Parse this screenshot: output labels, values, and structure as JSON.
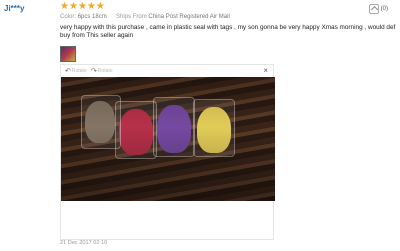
{
  "review": {
    "reviewer": "Ji***y",
    "rating": 5,
    "color_label": "Color:",
    "color_value": "6pcs 18cm",
    "shipping_label": "Ships From",
    "shipping_value": "China Post Registered Air Mail",
    "helpful_count": "(0)",
    "text": "very happy with this purchase , came in plastic seal with tags , my son gonna be very happy Xmas morning , would def buy from This seller again",
    "date": "21 Dec 2017 02:10"
  },
  "viewer": {
    "rotate_left_label": "Rotate",
    "rotate_right_label": "Rotate",
    "close_glyph": "×"
  },
  "icons": {
    "rotate_left": "↶",
    "rotate_right": "↷",
    "star": "★"
  },
  "colors": {
    "star": "#f5a623",
    "reviewer": "#1f6fb2"
  }
}
